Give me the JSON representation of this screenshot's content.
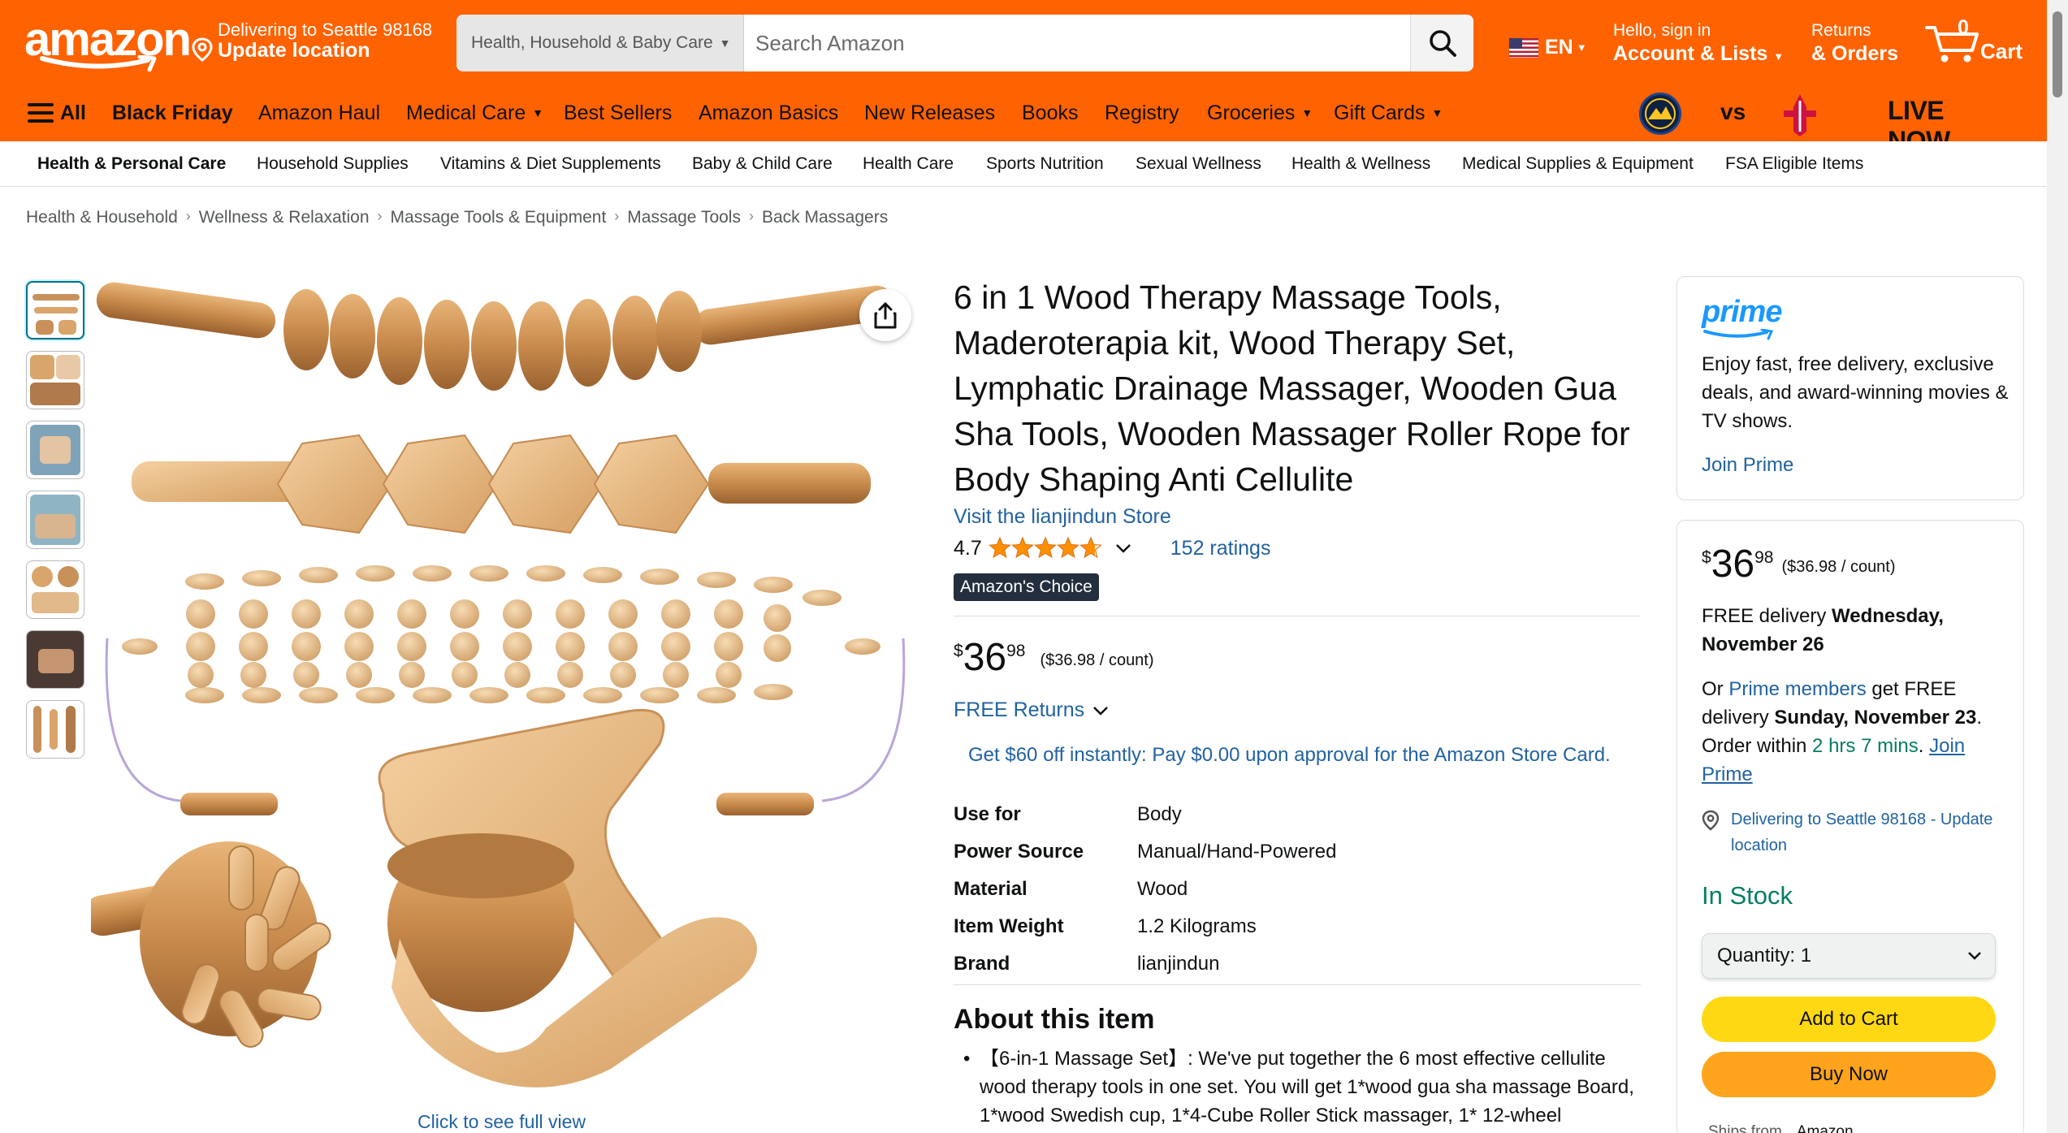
{
  "header": {
    "logo": "amazon",
    "delivery_line1": "Delivering to Seattle 98168",
    "delivery_line2": "Update location",
    "search_category": "Health, Household & Baby Care",
    "search_placeholder": "Search Amazon",
    "language": "EN",
    "account_line1": "Hello, sign in",
    "account_line2": "Account & Lists",
    "returns_line1": "Returns",
    "returns_line2": "& Orders",
    "cart_count": "0",
    "cart_label": "Cart",
    "brand_color": "#ff6200"
  },
  "main_nav": {
    "all": "All",
    "items": [
      "Black Friday",
      "Amazon Haul",
      "Medical Care",
      "Best Sellers",
      "Amazon Basics",
      "New Releases",
      "Books",
      "Registry",
      "Groceries",
      "Gift Cards"
    ],
    "live_vs": "vs",
    "live_now": "LIVE NOW"
  },
  "sub_nav": {
    "items": [
      "Health & Personal Care",
      "Household Supplies",
      "Vitamins & Diet Supplements",
      "Baby & Child Care",
      "Health Care",
      "Sports Nutrition",
      "Sexual Wellness",
      "Health & Wellness",
      "Medical Supplies & Equipment",
      "FSA Eligible Items"
    ]
  },
  "breadcrumb": [
    "Health & Household",
    "Wellness & Relaxation",
    "Massage Tools & Equipment",
    "Massage Tools",
    "Back Massagers"
  ],
  "gallery": {
    "full_view": "Click to see full view"
  },
  "product": {
    "title": "6 in 1 Wood Therapy Massage Tools, Maderoterapia kit, Wood Therapy Set, Lymphatic Drainage Massager, Wooden Gua Sha Tools, Wooden Massager Roller Rope for Body Shaping Anti Cellulite",
    "store": "Visit the lianjindun Store",
    "rating": "4.7",
    "rating_value": 4.7,
    "ratings_count": "152 ratings",
    "badge": "Amazon's Choice",
    "price_symbol": "$",
    "price_whole": "36",
    "price_fraction": "98",
    "price_unit": "($36.98 / count)",
    "returns": "FREE Returns",
    "promo": "Get $60 off instantly: Pay $0.00 upon approval for the Amazon Store Card.",
    "specs": [
      {
        "key": "Use for",
        "value": "Body"
      },
      {
        "key": "Power Source",
        "value": "Manual/Hand-Powered"
      },
      {
        "key": "Material",
        "value": "Wood"
      },
      {
        "key": "Item Weight",
        "value": "1.2 Kilograms"
      },
      {
        "key": "Brand",
        "value": "lianjindun"
      }
    ],
    "about_heading": "About this item",
    "about_bullet": "【6-in-1 Massage Set】: We've put together the 6 most effective cellulite wood therapy tools in one set. You will get 1*wood gua sha massage Board, 1*wood Swedish cup, 1*4-Cube Roller Stick massager, 1* 12-wheel"
  },
  "prime": {
    "logo": "prime",
    "text": "Enjoy fast, free delivery, exclusive deals, and award-winning movies & TV shows.",
    "join": "Join Prime"
  },
  "buy_box": {
    "price_symbol": "$",
    "price_whole": "36",
    "price_fraction": "98",
    "price_unit": "($36.98 / count)",
    "delivery_prefix": "FREE delivery ",
    "delivery_date": "Wednesday, November 26",
    "or_prefix": "Or ",
    "prime_members": "Prime members",
    "or_mid": " get FREE delivery ",
    "prime_date": "Sunday, November 23",
    "order_within": ". Order within ",
    "countdown": "2 hrs 7 mins",
    "join_prime": "Join Prime",
    "location": "Delivering to Seattle 98168 - Update location",
    "stock": "In Stock",
    "quantity": "Quantity: 1",
    "add_to_cart": "Add to Cart",
    "buy_now": "Buy Now",
    "ships_from_label": "Ships from",
    "ships_from_value": "Amazon"
  }
}
